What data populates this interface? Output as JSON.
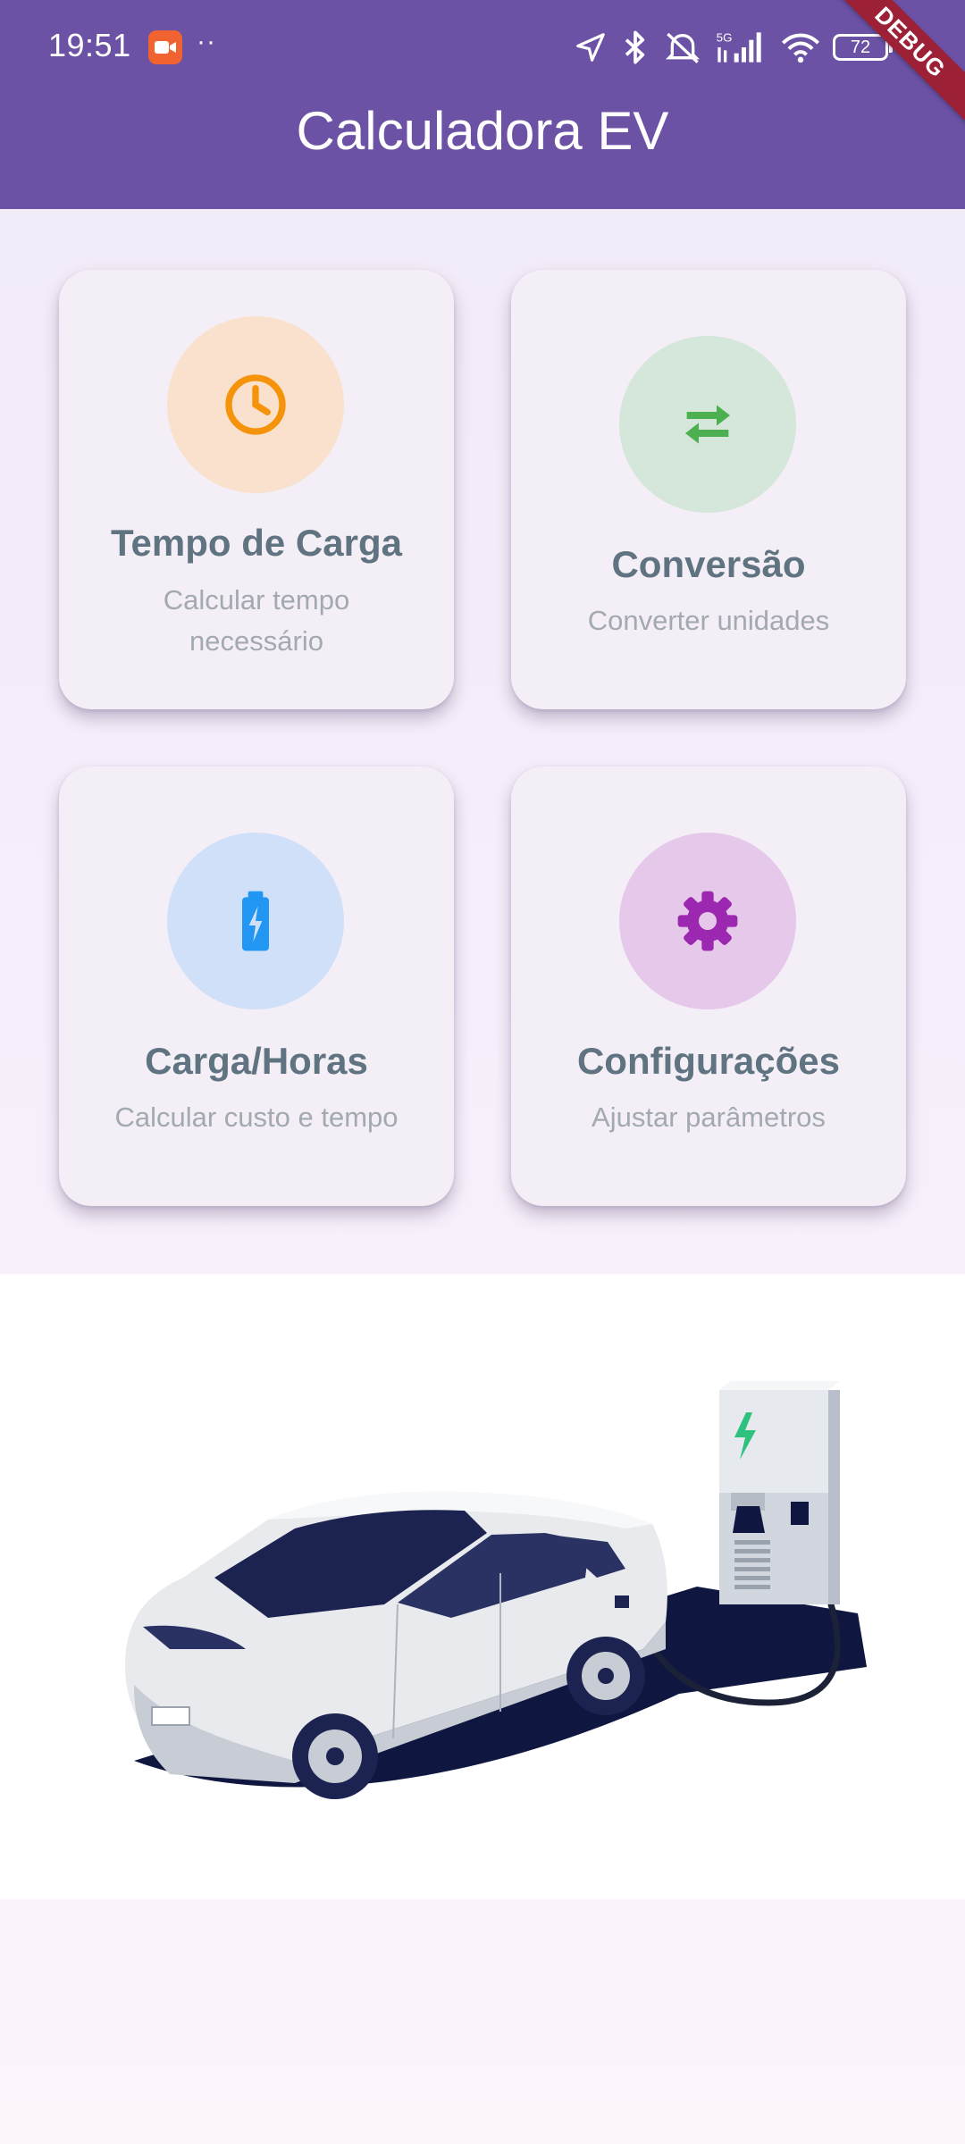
{
  "status_bar": {
    "time": "19:51",
    "dots": "··",
    "network": "5G",
    "battery": "72",
    "icons": [
      "camera-record-icon",
      "location-arrow-icon",
      "bluetooth-icon",
      "mute-icon",
      "signal-icon",
      "wifi-icon",
      "battery-icon"
    ]
  },
  "debug_banner": "DEBUG",
  "app_bar": {
    "title": "Calculadora EV",
    "color": "#6b52a5"
  },
  "cards": [
    {
      "title": "Tempo de Carga",
      "subtitle": "Calcular tempo necessário",
      "icon": "clock-icon",
      "icon_color": "#f5930b",
      "circle_color": "#f9e1cd"
    },
    {
      "title": "Conversão",
      "subtitle": "Converter unidades",
      "icon": "swap-arrows-icon",
      "icon_color": "#4caf50",
      "circle_color": "#d5e7db"
    },
    {
      "title": "Carga/Horas",
      "subtitle": "Calcular custo e tempo",
      "icon": "battery-charging-icon",
      "icon_color": "#2196f3",
      "circle_color": "#cfe0f8"
    },
    {
      "title": "Configurações",
      "subtitle": "Ajustar parâmetros",
      "icon": "gear-icon",
      "icon_color": "#9c27b0",
      "circle_color": "#e5c8ea"
    }
  ],
  "illustration": {
    "description_icon": "ev-charging-illustration"
  }
}
